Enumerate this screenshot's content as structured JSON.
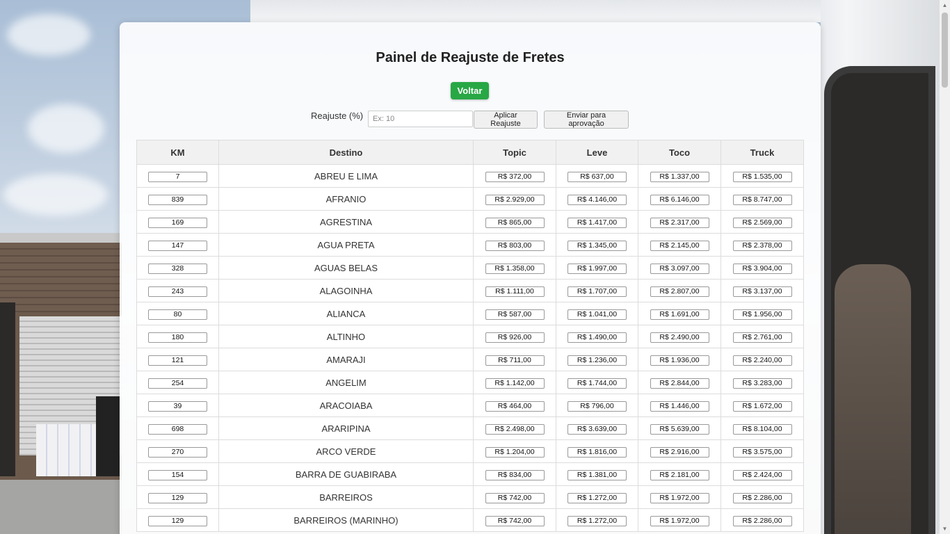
{
  "page": {
    "title": "Painel de Reajuste de Fretes",
    "back_label": "Voltar",
    "adjust_label": "Reajuste (%)",
    "adjust_placeholder": "Ex: 10",
    "adjust_value": "",
    "apply_label": "Aplicar Reajuste",
    "send_label": "Enviar para aprovação"
  },
  "table": {
    "headers": [
      "KM",
      "Destino",
      "Topic",
      "Leve",
      "Toco",
      "Truck"
    ],
    "rows": [
      {
        "km": "7",
        "destino": "ABREU E LIMA",
        "topic": "R$ 372,00",
        "leve": "R$ 637,00",
        "toco": "R$ 1.337,00",
        "truck": "R$ 1.535,00"
      },
      {
        "km": "839",
        "destino": "AFRANIO",
        "topic": "R$ 2.929,00",
        "leve": "R$ 4.146,00",
        "toco": "R$ 6.146,00",
        "truck": "R$ 8.747,00"
      },
      {
        "km": "169",
        "destino": "AGRESTINA",
        "topic": "R$ 865,00",
        "leve": "R$ 1.417,00",
        "toco": "R$ 2.317,00",
        "truck": "R$ 2.569,00"
      },
      {
        "km": "147",
        "destino": "AGUA PRETA",
        "topic": "R$ 803,00",
        "leve": "R$ 1.345,00",
        "toco": "R$ 2.145,00",
        "truck": "R$ 2.378,00"
      },
      {
        "km": "328",
        "destino": "AGUAS BELAS",
        "topic": "R$ 1.358,00",
        "leve": "R$ 1.997,00",
        "toco": "R$ 3.097,00",
        "truck": "R$ 3.904,00"
      },
      {
        "km": "243",
        "destino": "ALAGOINHA",
        "topic": "R$ 1.111,00",
        "leve": "R$ 1.707,00",
        "toco": "R$ 2.807,00",
        "truck": "R$ 3.137,00"
      },
      {
        "km": "80",
        "destino": "ALIANCA",
        "topic": "R$ 587,00",
        "leve": "R$ 1.041,00",
        "toco": "R$ 1.691,00",
        "truck": "R$ 1.956,00"
      },
      {
        "km": "180",
        "destino": "ALTINHO",
        "topic": "R$ 926,00",
        "leve": "R$ 1.490,00",
        "toco": "R$ 2.490,00",
        "truck": "R$ 2.761,00"
      },
      {
        "km": "121",
        "destino": "AMARAJI",
        "topic": "R$ 711,00",
        "leve": "R$ 1.236,00",
        "toco": "R$ 1.936,00",
        "truck": "R$ 2.240,00"
      },
      {
        "km": "254",
        "destino": "ANGELIM",
        "topic": "R$ 1.142,00",
        "leve": "R$ 1.744,00",
        "toco": "R$ 2.844,00",
        "truck": "R$ 3.283,00"
      },
      {
        "km": "39",
        "destino": "ARACOIABA",
        "topic": "R$ 464,00",
        "leve": "R$ 796,00",
        "toco": "R$ 1.446,00",
        "truck": "R$ 1.672,00"
      },
      {
        "km": "698",
        "destino": "ARARIPINA",
        "topic": "R$ 2.498,00",
        "leve": "R$ 3.639,00",
        "toco": "R$ 5.639,00",
        "truck": "R$ 8.104,00"
      },
      {
        "km": "270",
        "destino": "ARCO VERDE",
        "topic": "R$ 1.204,00",
        "leve": "R$ 1.816,00",
        "toco": "R$ 2.916,00",
        "truck": "R$ 3.575,00"
      },
      {
        "km": "154",
        "destino": "BARRA DE GUABIRABA",
        "topic": "R$ 834,00",
        "leve": "R$ 1.381,00",
        "toco": "R$ 2.181,00",
        "truck": "R$ 2.424,00"
      },
      {
        "km": "129",
        "destino": "BARREIROS",
        "topic": "R$ 742,00",
        "leve": "R$ 1.272,00",
        "toco": "R$ 1.972,00",
        "truck": "R$ 2.286,00"
      },
      {
        "km": "129",
        "destino": "BARREIROS (MARINHO)",
        "topic": "R$ 742,00",
        "leve": "R$ 1.272,00",
        "toco": "R$ 1.972,00",
        "truck": "R$ 2.286,00"
      }
    ]
  },
  "colors": {
    "back_button": "#28a745",
    "header_bg": "#f1f1f1",
    "panel_bg": "#ffffff"
  }
}
